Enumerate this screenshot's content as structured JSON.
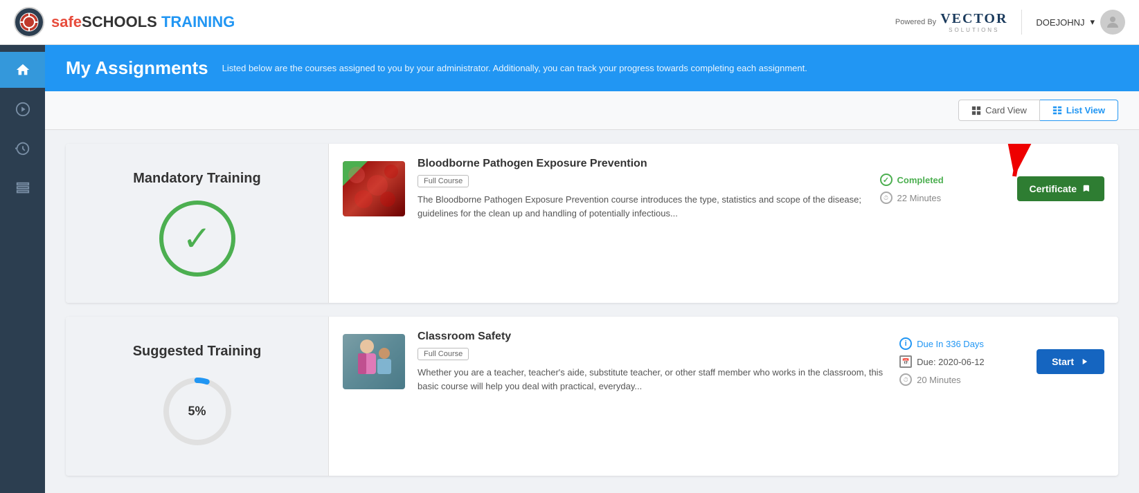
{
  "header": {
    "logo_safe": "safe",
    "logo_schools": "SCHOOLS",
    "logo_training": "TRAINING",
    "powered_by": "Powered By",
    "vector_brand": "VECTOR",
    "vector_sub": "SOLUTIONS",
    "username": "DOEJOHNJ",
    "chevron": "▾"
  },
  "page_title": "My Assignments",
  "page_subtitle": "Listed below are the courses assigned to you by your administrator. Additionally, you can track your progress towards completing each assignment.",
  "view_toggle": {
    "card_view": "Card View",
    "list_view": "List View"
  },
  "sidebar": {
    "items": [
      {
        "icon": "⌂",
        "label": "home-icon",
        "active": true
      },
      {
        "icon": "▶",
        "label": "play-icon",
        "active": false
      },
      {
        "icon": "↺",
        "label": "history-icon",
        "active": false
      },
      {
        "icon": "☰",
        "label": "menu-icon",
        "active": false
      }
    ]
  },
  "sections": [
    {
      "id": "mandatory",
      "label": "Mandatory Training",
      "completed": true,
      "progress_percent": null,
      "courses": [
        {
          "id": "bloodborne",
          "title": "Bloodborne Pathogen Exposure Prevention",
          "badge": "Full Course",
          "description": "The Bloodborne Pathogen Exposure Prevention course introduces the type, statistics and scope of the disease; guidelines for the clean up and handling of potentially infectious...",
          "status": "Completed",
          "duration": "22 Minutes",
          "action": "Certificate",
          "thumb_type": "bloodborne",
          "has_check_badge": true,
          "due_days": null,
          "due_date": null
        }
      ]
    },
    {
      "id": "suggested",
      "label": "Suggested Training",
      "completed": false,
      "progress_percent": "5%",
      "courses": [
        {
          "id": "classroom",
          "title": "Classroom Safety",
          "badge": "Full Course",
          "description": "Whether you are a teacher, teacher's aide, substitute teacher, or other staff member who works in the classroom, this basic course will help you deal with practical, everyday...",
          "status": null,
          "duration": "20 Minutes",
          "action": "Start",
          "thumb_type": "classroom",
          "has_check_badge": false,
          "due_days": "Due In 336 Days",
          "due_date": "Due: 2020-06-12"
        }
      ]
    }
  ],
  "icons": {
    "grid": "⊞",
    "list": "≡",
    "arrow_right": "→",
    "external_link": "↗"
  }
}
